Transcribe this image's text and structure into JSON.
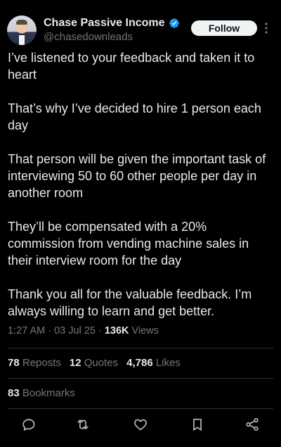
{
  "user": {
    "display_name": "Chase Passive Income",
    "handle": "@chasedownleads",
    "avatar_icon": "profile-photo",
    "verified_color": "#1d9bf0"
  },
  "header": {
    "follow_label": "Follow",
    "more_icon": "more-vertical-icon"
  },
  "tweet": {
    "paragraphs": [
      "I’ve listened to your feedback and taken it to heart",
      "That’s why I’ve decided to hire 1 person each day",
      "That person will be given the important task of interviewing 50 to 60 other people per day in another room",
      "They’ll be compensated with a 20% commission from vending machine sales in their interview room for the day",
      "Thank you all for the valuable feedback. I’m always willing to learn and get better."
    ],
    "time": "1:27 AM",
    "date": "03 Jul 25",
    "views_count": "136K",
    "views_label": "Views"
  },
  "stats": {
    "reposts_count": "78",
    "reposts_label": "Reposts",
    "quotes_count": "12",
    "quotes_label": "Quotes",
    "likes_count": "4,786",
    "likes_label": "Likes",
    "bookmarks_count": "83",
    "bookmarks_label": "Bookmarks"
  },
  "actions": [
    "reply-icon",
    "repost-icon",
    "like-icon",
    "bookmark-icon",
    "share-icon"
  ],
  "colors": {
    "background": "#000000",
    "text": "#e7e9ea",
    "muted": "#71767b",
    "divider": "#2f3336"
  }
}
